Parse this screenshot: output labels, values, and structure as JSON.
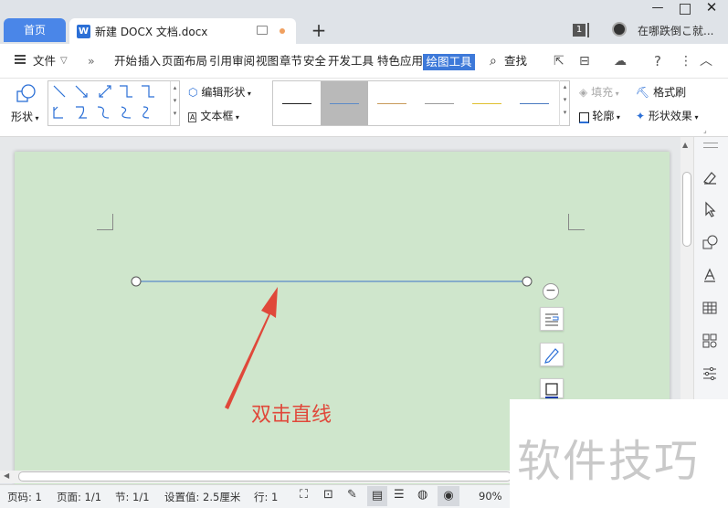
{
  "tabs": {
    "home": "首页",
    "document": "新建 DOCX 文档.docx",
    "add": "+"
  },
  "titlebar": {
    "badge": "1",
    "user": "在哪跌倒こ就..."
  },
  "menu": {
    "file": "文件",
    "items": [
      "开始",
      "插入",
      "页面布局",
      "引用",
      "审阅",
      "视图",
      "章节",
      "安全",
      "开发工具",
      "特色应用"
    ],
    "active": "绘图工具",
    "search": "查找"
  },
  "ribbon": {
    "shape": "形状",
    "edit_shape": "编辑形状",
    "text_box": "文本框",
    "fill": "填充",
    "format_painter": "格式刷",
    "outline": "轮廓",
    "shape_effect": "形状效果"
  },
  "line_styles": [
    {
      "color": "#222222"
    },
    {
      "color": "#5b8ac8"
    },
    {
      "color": "#c89a5b"
    },
    {
      "color": "#9a9a9a"
    },
    {
      "color": "#e0c030"
    },
    {
      "color": "#4a7ac0"
    }
  ],
  "annotation": "双击直线",
  "status": {
    "page_num": "页码: 1",
    "pages": "页面: 1/1",
    "section": "节: 1/1",
    "setting": "设置值: 2.5厘米",
    "row": "行: 1",
    "zoom": "90%"
  },
  "watermark": "软件技巧",
  "colors": {
    "accent": "#3d79d9",
    "page_bg": "#cfe6cc",
    "annotation": "#e0483a",
    "line": "#5b8ac8"
  }
}
